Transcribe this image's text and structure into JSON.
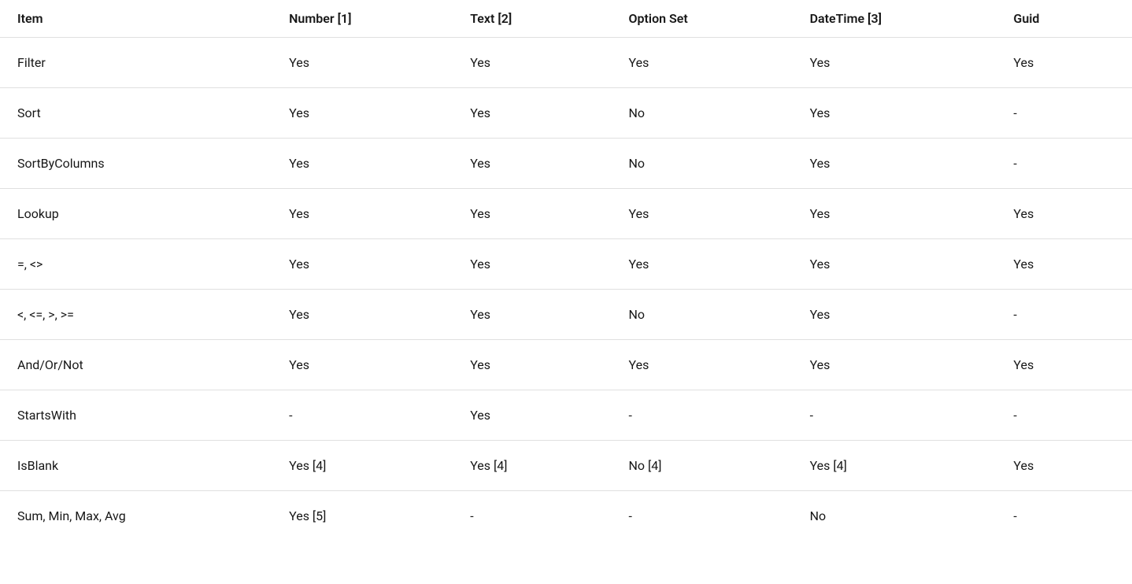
{
  "table": {
    "headers": [
      "Item",
      "Number [1]",
      "Text [2]",
      "Option Set",
      "DateTime [3]",
      "Guid"
    ],
    "rows": [
      {
        "cells": [
          "Filter",
          "Yes",
          "Yes",
          "Yes",
          "Yes",
          "Yes"
        ]
      },
      {
        "cells": [
          "Sort",
          "Yes",
          "Yes",
          "No",
          "Yes",
          "-"
        ]
      },
      {
        "cells": [
          "SortByColumns",
          "Yes",
          "Yes",
          "No",
          "Yes",
          "-"
        ]
      },
      {
        "cells": [
          "Lookup",
          "Yes",
          "Yes",
          "Yes",
          "Yes",
          "Yes"
        ]
      },
      {
        "cells": [
          "=, <>",
          "Yes",
          "Yes",
          "Yes",
          "Yes",
          "Yes"
        ]
      },
      {
        "cells": [
          "<, <=, >, >=",
          "Yes",
          "Yes",
          "No",
          "Yes",
          "-"
        ]
      },
      {
        "cells": [
          "And/Or/Not",
          "Yes",
          "Yes",
          "Yes",
          "Yes",
          "Yes"
        ]
      },
      {
        "cells": [
          "StartsWith",
          "-",
          "Yes",
          "-",
          "-",
          "-"
        ]
      },
      {
        "cells": [
          "IsBlank",
          "Yes [4]",
          "Yes [4]",
          "No [4]",
          "Yes [4]",
          "Yes"
        ]
      },
      {
        "cells": [
          "Sum, Min, Max, Avg",
          "Yes [5]",
          "-",
          "-",
          "No",
          "-"
        ]
      }
    ]
  }
}
